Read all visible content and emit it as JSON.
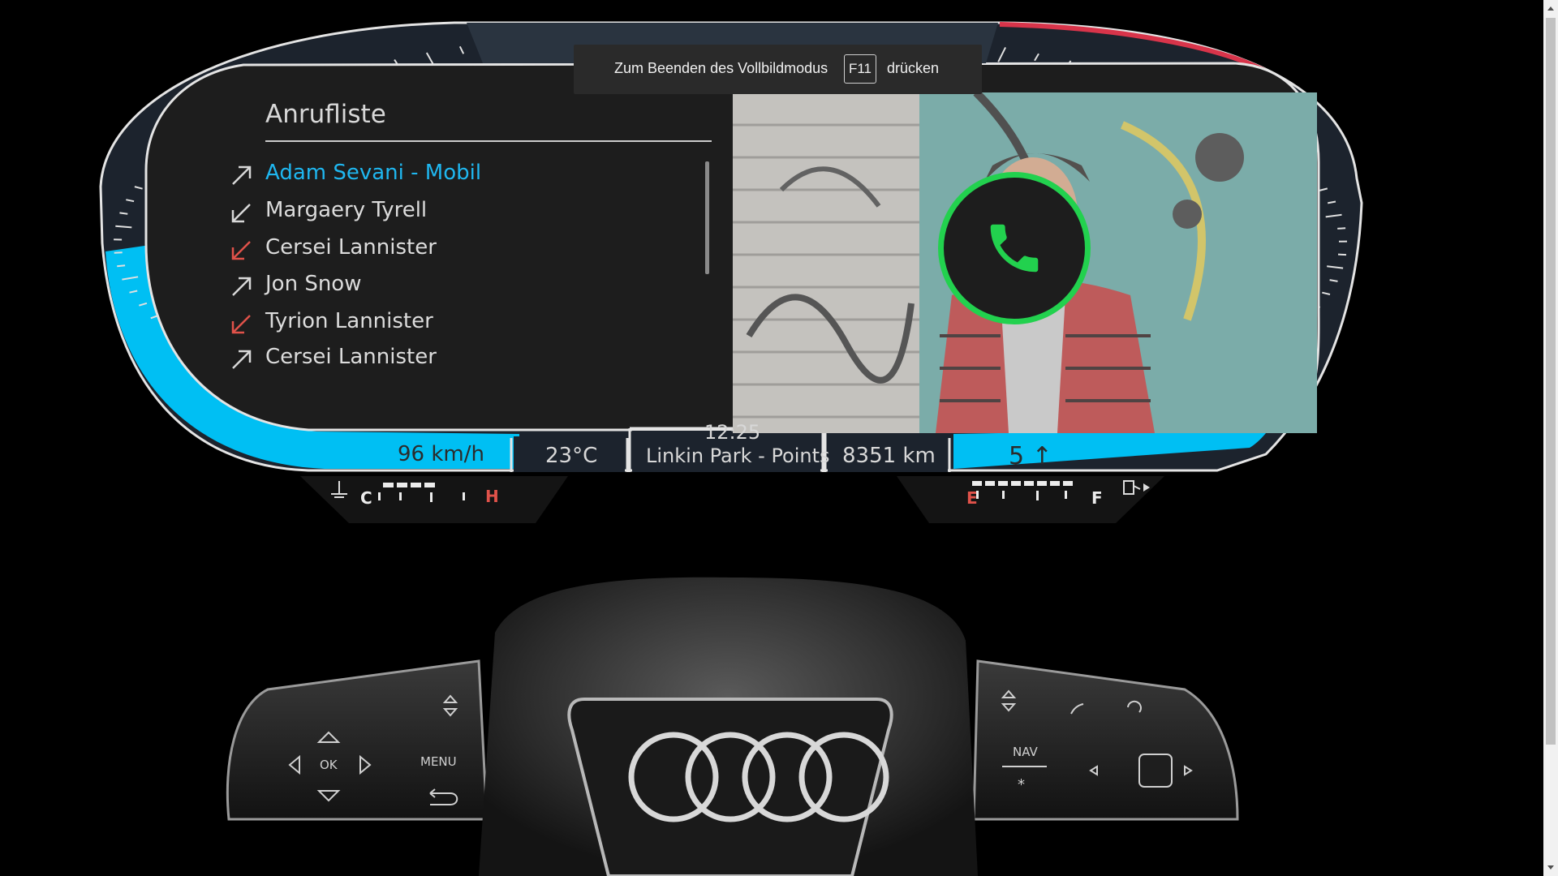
{
  "fullscreen_notice": {
    "before": "Zum Beenden des Vollbildmodus",
    "key": "F11",
    "after": "drücken"
  },
  "call_list": {
    "title": "Anrufliste",
    "items": [
      {
        "name": "Adam Sevani - Mobil",
        "type": "outgoing",
        "selected": true
      },
      {
        "name": "Margaery Tyrell",
        "type": "incoming",
        "selected": false
      },
      {
        "name": "Cersei Lannister",
        "type": "missed",
        "selected": false
      },
      {
        "name": "Jon Snow",
        "type": "outgoing",
        "selected": false
      },
      {
        "name": "Tyrion Lannister",
        "type": "missed",
        "selected": false
      },
      {
        "name": "Cersei Lannister",
        "type": "outgoing",
        "selected": false
      }
    ]
  },
  "call_button": {
    "icon": "phone-icon"
  },
  "status_bar": {
    "speed": "96 km/h",
    "temperature": "23°C",
    "time": "12:25",
    "track": "Linkin Park - Points",
    "odometer": "8351 km",
    "gear": "5"
  },
  "gauges": {
    "coolant": {
      "low": "C",
      "high": "H",
      "icon": "coolant-temperature-icon"
    },
    "fuel": {
      "low": "E",
      "high": "F",
      "icon": "fuel-pump-icon"
    }
  },
  "steering_wheel": {
    "left_controls": {
      "ok": "OK",
      "menu": "MENU"
    },
    "right_controls": {
      "nav": "NAV"
    },
    "logo": "four-rings-logo"
  },
  "colors": {
    "accent_blue": "#00bff3",
    "call_green": "#22d14e",
    "missed_red": "#e0524a",
    "redline": "#d8344a"
  }
}
